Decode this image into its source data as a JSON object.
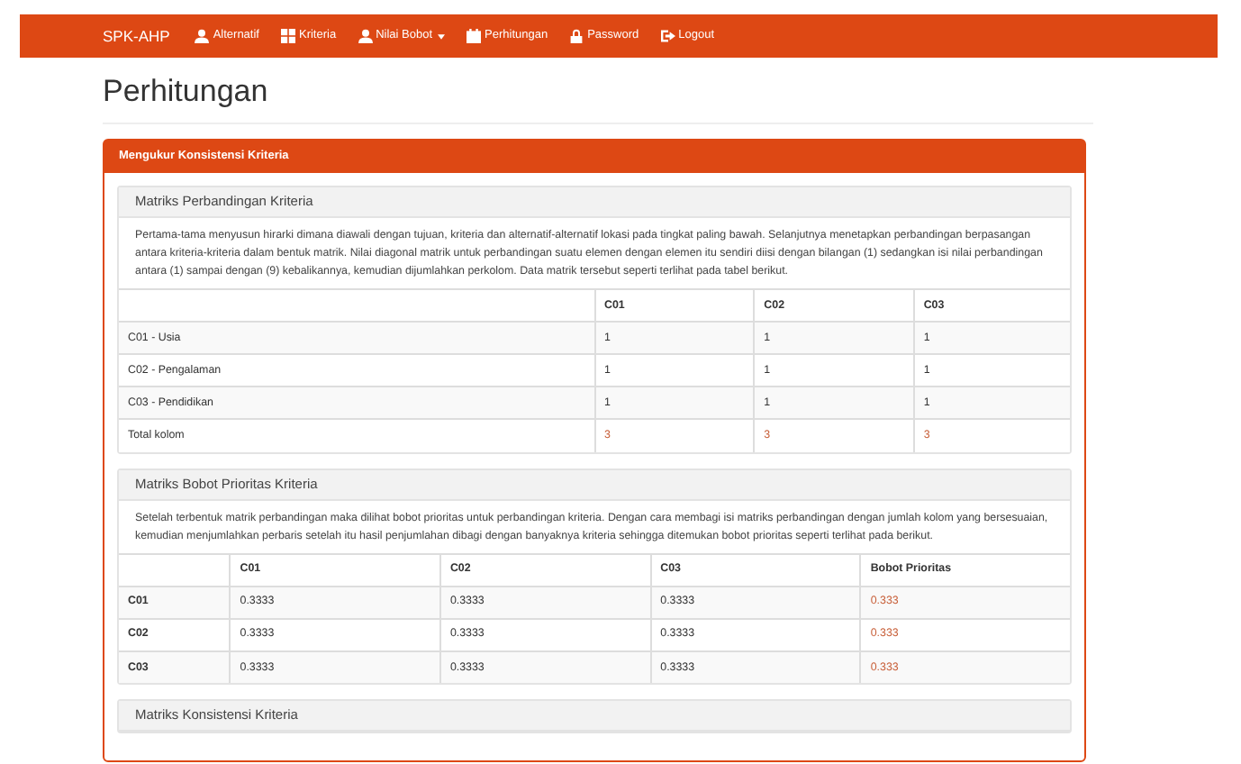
{
  "navbar": {
    "brand": "SPK-AHP",
    "items": [
      {
        "label": "Alternatif",
        "kind": "user",
        "dropdown": false
      },
      {
        "label": "Kriteria",
        "kind": "grid",
        "dropdown": false
      },
      {
        "label": "Nilai Bobot",
        "kind": "user",
        "dropdown": true
      },
      {
        "label": "Perhitungan",
        "kind": "calendar",
        "dropdown": false
      },
      {
        "label": "Password",
        "kind": "lock",
        "dropdown": false
      },
      {
        "label": "Logout",
        "kind": "logout",
        "dropdown": false
      }
    ]
  },
  "page_title": "Perhitungan",
  "panel": {
    "title": "Mengukur Konsistensi Kriteria",
    "sections": [
      {
        "title": "Matriks Perbandingan Kriteria",
        "description": "Pertama-tama menyusun hirarki dimana diawali dengan tujuan, kriteria dan alternatif-alternatif lokasi pada tingkat paling bawah. Selanjutnya menetapkan perbandingan berpasangan antara kriteria-kriteria dalam bentuk matrik. Nilai diagonal matrik untuk perbandingan suatu elemen dengan elemen itu sendiri diisi dengan bilangan (1) sedangkan isi nilai perbandingan antara (1) sampai dengan (9) kebalikannya, kemudian dijumlahkan perkolom. Data matrik tersebut seperti terlihat pada tabel berikut.",
        "table": {
          "columns": [
            {
              "kind": "name"
            },
            {
              "label": "C01",
              "kind": "value"
            },
            {
              "label": "C02",
              "kind": "value"
            },
            {
              "label": "C03",
              "kind": "value"
            }
          ],
          "rows": [
            {
              "kind": "data",
              "cells": [
                "C01 - Usia",
                "1",
                "1",
                "1"
              ]
            },
            {
              "kind": "data",
              "cells": [
                "C02 - Pengalaman",
                "1",
                "1",
                "1"
              ]
            },
            {
              "kind": "data",
              "cells": [
                "C03 - Pendidikan",
                "1",
                "1",
                "1"
              ]
            },
            {
              "kind": "total",
              "cells": [
                "Total kolom",
                "3",
                "3",
                "3"
              ]
            }
          ]
        }
      },
      {
        "title": "Matriks Bobot Prioritas Kriteria",
        "description": "Setelah terbentuk matrik perbandingan maka dilihat bobot prioritas untuk perbandingan kriteria. Dengan cara membagi isi matriks perbandingan dengan jumlah kolom yang bersesuaian, kemudian menjumlahkan perbaris setelah itu hasil penjumlahan dibagi dengan banyaknya kriteria sehingga ditemukan bobot prioritas seperti terlihat pada berikut.",
        "table": {
          "columns": [
            {
              "kind": "code"
            },
            {
              "label": "C01",
              "kind": "value"
            },
            {
              "label": "C02",
              "kind": "value"
            },
            {
              "label": "C03",
              "kind": "value"
            },
            {
              "label": "Bobot Prioritas",
              "kind": "result"
            }
          ],
          "rows": [
            {
              "kind": "data",
              "cells": [
                "C01",
                "0.3333",
                "0.3333",
                "0.3333",
                "0.333"
              ]
            },
            {
              "kind": "data",
              "cells": [
                "C02",
                "0.3333",
                "0.3333",
                "0.3333",
                "0.333"
              ]
            },
            {
              "kind": "data",
              "cells": [
                "C03",
                "0.3333",
                "0.3333",
                "0.3333",
                "0.333"
              ]
            }
          ]
        }
      },
      {
        "title": "Matriks Konsistensi Kriteria"
      }
    ]
  }
}
